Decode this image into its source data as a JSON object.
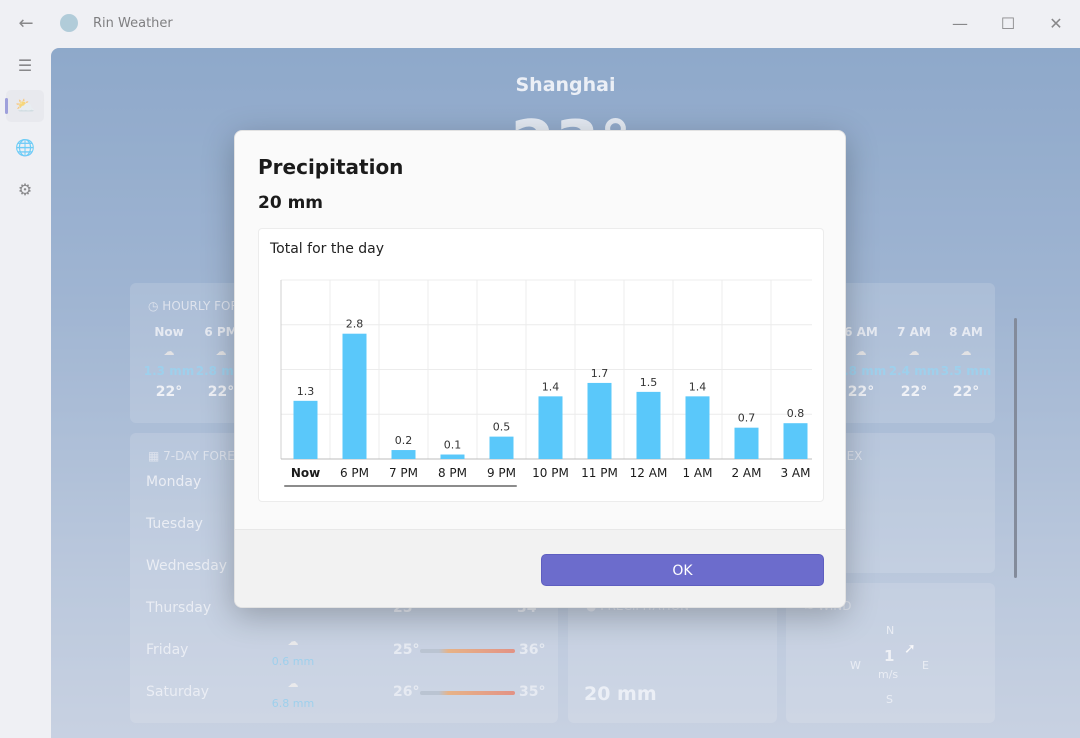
{
  "window": {
    "title": "Rin Weather",
    "back_icon": "←",
    "minimize_icon": "—",
    "maximize_icon": "☐",
    "close_icon": "✕"
  },
  "rail": {
    "menu_icon": "☰",
    "weather_icon": "⛅",
    "globe_icon": "🌐",
    "settings_icon": "⚙"
  },
  "background": {
    "city": "Shanghai",
    "temperature": "23°",
    "hourly": {
      "header": "HOURLY FORECAST",
      "left_items": [
        {
          "time": "Now",
          "mm": "1.3 mm",
          "temp": "22°"
        },
        {
          "time": "6 PM",
          "mm": "2.8 mm",
          "temp": "22°"
        }
      ],
      "right_items": [
        {
          "time": "6 AM",
          "mm": "1.8 mm",
          "temp": "22°"
        },
        {
          "time": "7 AM",
          "mm": "2.4 mm",
          "temp": "22°"
        },
        {
          "time": "8 AM",
          "mm": "3.5 mm",
          "temp": "22°"
        }
      ]
    },
    "seven_day": {
      "header": "7-DAY FORECAST",
      "days": [
        {
          "name": "Monday"
        },
        {
          "name": "Tuesday"
        },
        {
          "name": "Wednesday"
        },
        {
          "name": "Thursday",
          "lo": "25°",
          "hi": "34°"
        },
        {
          "name": "Friday",
          "mm": "0.6 mm",
          "lo": "25°",
          "hi": "36°"
        },
        {
          "name": "Saturday",
          "mm": "6.8 mm",
          "lo": "26°",
          "hi": "35°"
        }
      ]
    },
    "uv_header": "UV INDEX",
    "precip_card": {
      "header": "PRECIPITATION",
      "value": "20 mm"
    },
    "wind_card": {
      "header": "WIND",
      "speed": "1",
      "unit": "m/s",
      "n": "N",
      "e": "E",
      "s": "S",
      "w": "W"
    }
  },
  "dialog": {
    "title": "Precipitation",
    "total": "20 mm",
    "chart_subtitle": "Total for the day",
    "ok_label": "OK"
  },
  "colors": {
    "bar": "#5ac8fa",
    "accent": "#6c6ccc"
  },
  "chart_data": {
    "type": "bar",
    "title": "",
    "xlabel": "",
    "ylabel": "",
    "categories": [
      "Now",
      "6 PM",
      "7 PM",
      "8 PM",
      "9 PM",
      "10 PM",
      "11 PM",
      "12 AM",
      "1 AM",
      "2 AM",
      "3 AM"
    ],
    "values": [
      1.3,
      2.8,
      0.2,
      0.1,
      0.5,
      1.4,
      1.7,
      1.5,
      1.4,
      0.7,
      0.8
    ],
    "labels": [
      "1.3",
      "2.8",
      "0.2",
      "0.1",
      "0.5",
      "1.4",
      "1.7",
      "1.5",
      "1.4",
      "0.7",
      "0.8"
    ],
    "ylim": [
      0,
      4
    ],
    "grid": true,
    "selected_category": "Now"
  }
}
